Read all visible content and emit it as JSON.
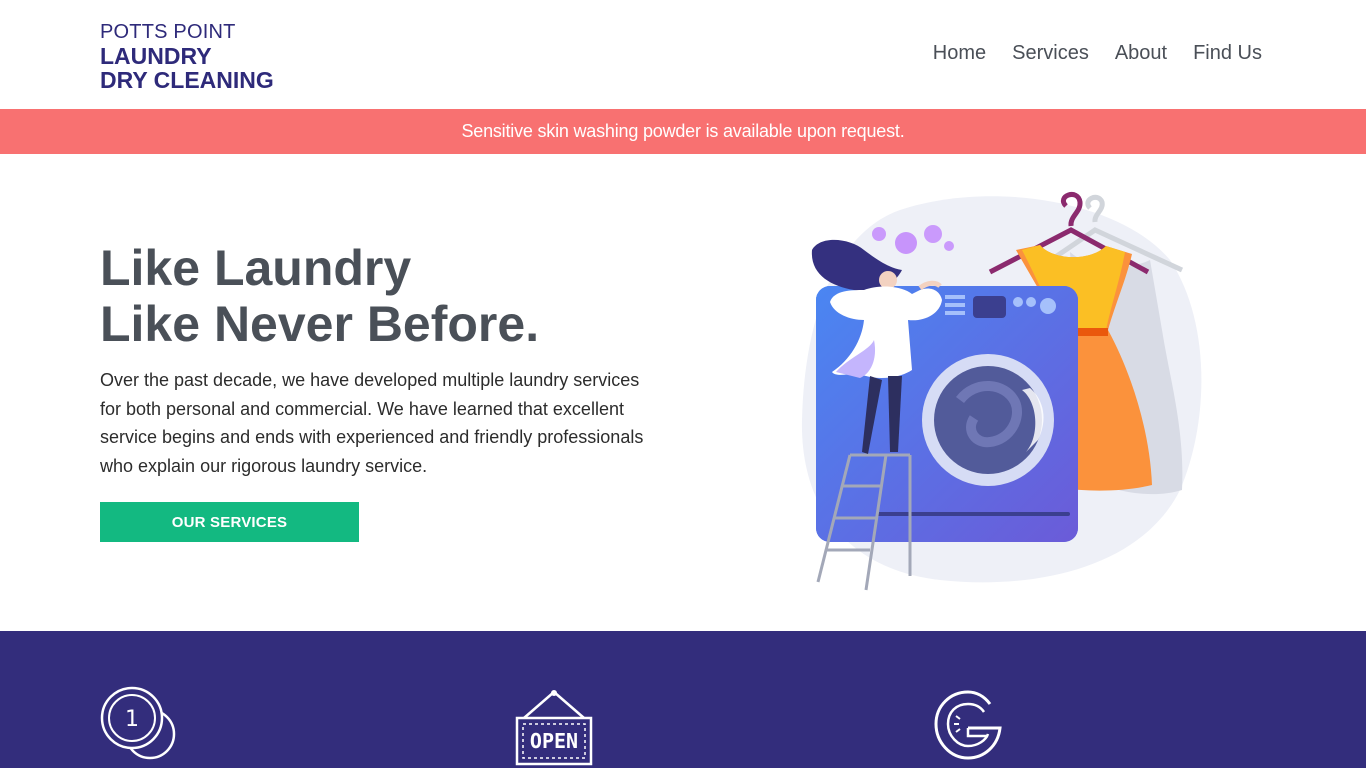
{
  "brand": {
    "line1": "POTTS POINT",
    "line2": "LAUNDRY",
    "line3": "DRY CLEANING",
    "color": "#2e2a7a"
  },
  "nav": {
    "items": [
      {
        "label": "Home"
      },
      {
        "label": "Services"
      },
      {
        "label": "About"
      },
      {
        "label": "Find Us"
      }
    ]
  },
  "notice": {
    "text": "Sensitive skin washing powder is available upon request.",
    "background": "#f87171"
  },
  "hero": {
    "title_line1": "Like Laundry",
    "title_line2": "Like Never Before.",
    "description": "Over the past decade, we have developed multiple laundry services for both personal and commercial. We have learned that excellent service begins and ends with experienced and friendly professionals who explain our rigorous laundry service.",
    "cta_label": "OUR SERVICES",
    "cta_color": "#13b981",
    "illustration": "woman-loading-washing-machine-illustration"
  },
  "features": {
    "background": "#332d7c",
    "icons": [
      "coin-icon",
      "open-sign-icon",
      "google-icon"
    ]
  }
}
